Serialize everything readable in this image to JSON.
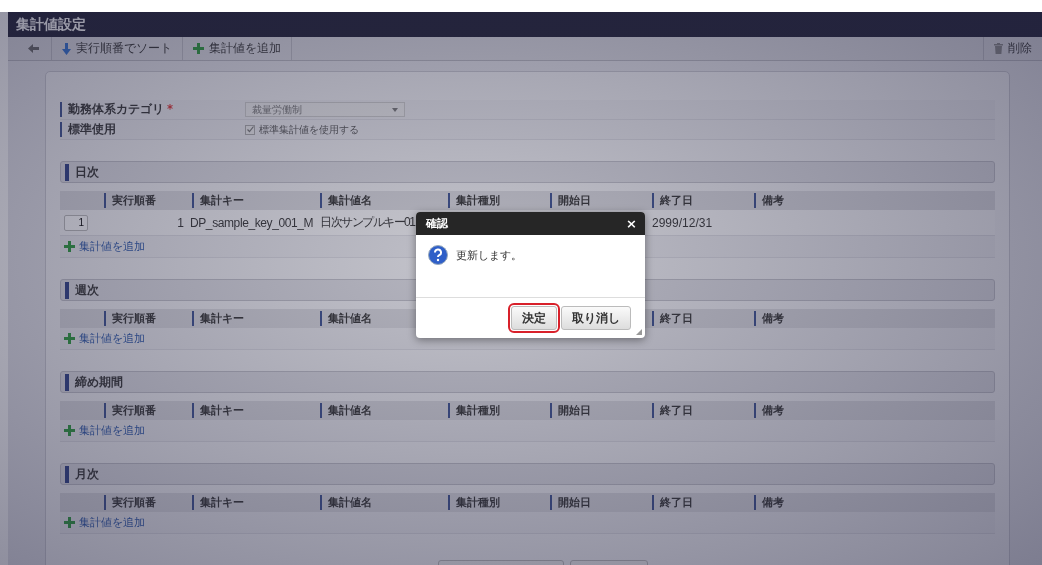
{
  "window": {
    "title": "集計値設定"
  },
  "toolbar": {
    "items": [
      {
        "kind": "back"
      },
      {
        "kind": "sort",
        "label": "実行順番でソート"
      },
      {
        "kind": "add",
        "label": "集計値を追加"
      }
    ],
    "delete_label": "削除"
  },
  "form": {
    "category": {
      "label": "勤務体系カテゴリ",
      "required_mark": "*",
      "value": "裁量労働制"
    },
    "standard": {
      "label": "標準使用",
      "checkbox_label": "標準集計値を使用する",
      "checked": true
    }
  },
  "sections": [
    {
      "title": "日次",
      "columns": [
        {
          "kind": "order",
          "label": "実行順番"
        },
        {
          "kind": "key",
          "label": "集計キー"
        },
        {
          "kind": "name",
          "label": "集計値名"
        },
        {
          "kind": "type",
          "label": "集計種別"
        },
        {
          "kind": "start",
          "label": "開始日"
        },
        {
          "kind": "end",
          "label": "終了日"
        },
        {
          "kind": "note",
          "label": "備考"
        }
      ],
      "rows": [
        {
          "order_input": "1",
          "order": "1",
          "key": "DP_sample_key_001_M",
          "name": "日次サンプルキー01",
          "end_date": "2999/12/31"
        }
      ],
      "add_link": "集計値を追加"
    },
    {
      "title": "週次",
      "columns": [
        {
          "kind": "order",
          "label": "実行順番"
        },
        {
          "kind": "key",
          "label": "集計キー"
        },
        {
          "kind": "name",
          "label": "集計値名"
        },
        {
          "kind": "end",
          "label": "終了日"
        },
        {
          "kind": "note",
          "label": "備考"
        }
      ],
      "add_link": "集計値を追加"
    },
    {
      "title": "締め期間",
      "columns": [
        {
          "kind": "order",
          "label": "実行順番"
        },
        {
          "kind": "key",
          "label": "集計キー"
        },
        {
          "kind": "name",
          "label": "集計値名"
        },
        {
          "kind": "type",
          "label": "集計種別"
        },
        {
          "kind": "start",
          "label": "開始日"
        },
        {
          "kind": "end",
          "label": "終了日"
        },
        {
          "kind": "note",
          "label": "備考"
        }
      ],
      "add_link": "集計値を追加"
    },
    {
      "title": "月次",
      "columns": [
        {
          "kind": "order",
          "label": "実行順番"
        },
        {
          "kind": "key",
          "label": "集計キー"
        },
        {
          "kind": "name",
          "label": "集計値名"
        },
        {
          "kind": "type",
          "label": "集計種別"
        },
        {
          "kind": "start",
          "label": "開始日"
        },
        {
          "kind": "end",
          "label": "終了日"
        },
        {
          "kind": "note",
          "label": "備考"
        }
      ],
      "add_link": "集計値を追加"
    }
  ],
  "dialog": {
    "title": "確認",
    "close": "×",
    "message": "更新します。",
    "buttons": [
      {
        "label": "決定",
        "focused": true
      },
      {
        "label": "取り消し",
        "focused": false
      }
    ]
  }
}
